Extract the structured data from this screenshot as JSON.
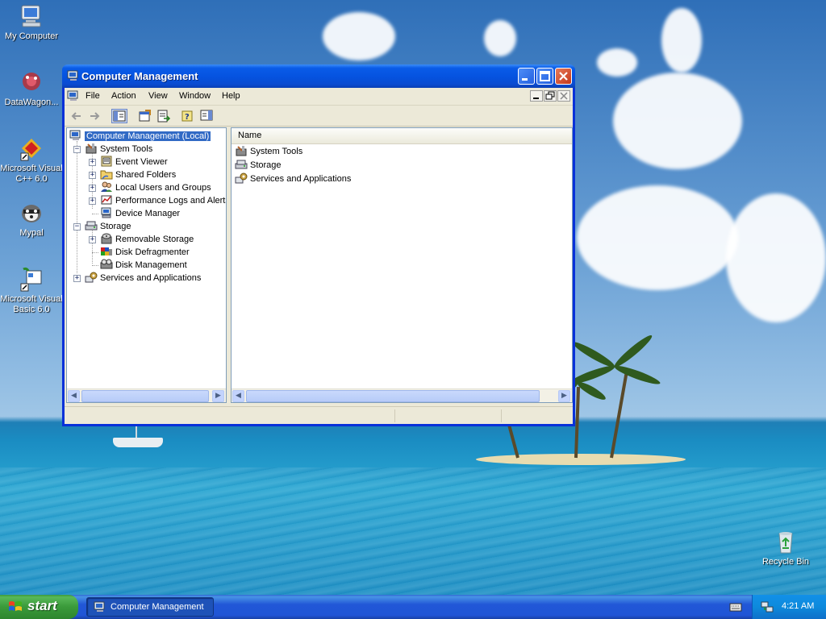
{
  "desktop": {
    "icons": [
      {
        "label": "My Computer",
        "icon": "my-computer-icon"
      },
      {
        "label": "DataWagon...",
        "icon": "datawagon-icon"
      },
      {
        "label": "Microsoft Visual C++ 6.0",
        "icon": "visual-cpp-icon"
      },
      {
        "label": "Mypal",
        "icon": "mypal-icon"
      },
      {
        "label": "Microsoft Visual Basic 6.0",
        "icon": "visual-basic-icon"
      },
      {
        "label": "Recycle Bin",
        "icon": "recycle-bin-icon"
      }
    ]
  },
  "window": {
    "title": "Computer Management",
    "menu": [
      "File",
      "Action",
      "View",
      "Window",
      "Help"
    ],
    "tree": {
      "root": "Computer Management (Local)",
      "system_tools": "System Tools",
      "event_viewer": "Event Viewer",
      "shared_folders": "Shared Folders",
      "local_users": "Local Users and Groups",
      "perf_logs": "Performance Logs and Alerts",
      "device_manager": "Device Manager",
      "storage": "Storage",
      "removable_storage": "Removable Storage",
      "disk_defrag": "Disk Defragmenter",
      "disk_mgmt": "Disk Management",
      "services_apps": "Services and Applications"
    },
    "list": {
      "column_name": "Name",
      "items": [
        "System Tools",
        "Storage",
        "Services and Applications"
      ]
    }
  },
  "taskbar": {
    "start_label": "start",
    "task_label": "Computer Management",
    "clock": "4:21 AM"
  },
  "colors": {
    "selection": "#316ac5",
    "titlebar": "#0a5ce8",
    "start": "#3a9a3a"
  }
}
